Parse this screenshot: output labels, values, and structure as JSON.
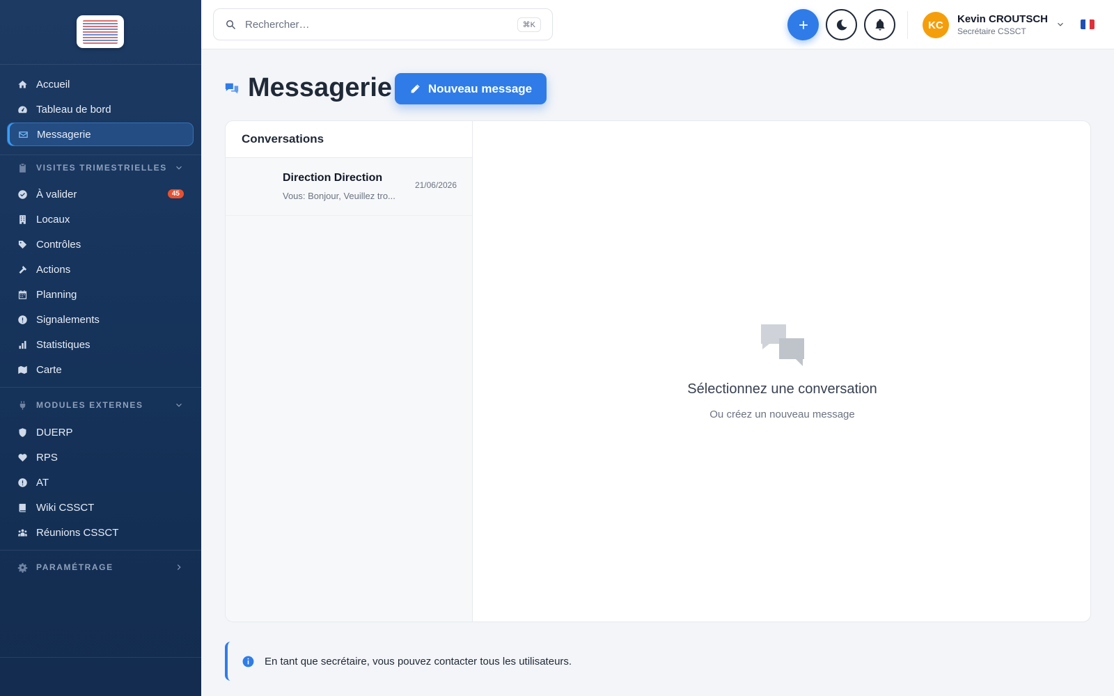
{
  "sidebar": {
    "nav_main": [
      {
        "label": "Accueil",
        "icon": "home-icon"
      },
      {
        "label": "Tableau de bord",
        "icon": "dashboard-icon"
      },
      {
        "label": "Messagerie",
        "icon": "envelope-icon"
      }
    ],
    "section_visites": "VISITES TRIMESTRIELLES",
    "visites_items": [
      {
        "label": "À valider",
        "icon": "check-circle-icon",
        "badge": "45"
      },
      {
        "label": "Locaux",
        "icon": "building-icon"
      },
      {
        "label": "Contrôles",
        "icon": "tag-icon"
      },
      {
        "label": "Actions",
        "icon": "hammer-icon"
      },
      {
        "label": "Planning",
        "icon": "calendar-icon"
      },
      {
        "label": "Signalements",
        "icon": "alert-icon"
      },
      {
        "label": "Statistiques",
        "icon": "bar-chart-icon"
      },
      {
        "label": "Carte",
        "icon": "map-icon"
      }
    ],
    "section_modules": "MODULES EXTERNES",
    "modules_items": [
      {
        "label": "DUERP",
        "icon": "shield-icon"
      },
      {
        "label": "RPS",
        "icon": "heart-icon"
      },
      {
        "label": "AT",
        "icon": "alert-icon"
      },
      {
        "label": "Wiki CSSCT",
        "icon": "book-icon"
      },
      {
        "label": "Réunions CSSCT",
        "icon": "users-icon"
      }
    ],
    "section_param": "PARAMÉTRAGE"
  },
  "topbar": {
    "search_placeholder": "Rechercher…",
    "search_shortcut": "⌘K",
    "user_initials": "KC",
    "user_name": "Kevin CROUTSCH",
    "user_role": "Secrétaire CSSCT"
  },
  "page": {
    "title": "Messagerie",
    "new_message_label": "Nouveau message"
  },
  "conversations": {
    "header": "Conversations",
    "items": [
      {
        "name": "Direction Direction",
        "preview": "Vous: Bonjour, Veuillez tro...",
        "date": "21/06/2026"
      }
    ]
  },
  "empty_state": {
    "title": "Sélectionnez une conversation",
    "subtitle": "Ou créez un nouveau message"
  },
  "info_banner": {
    "text": "En tant que secrétaire, vous pouvez contacter tous les utilisateurs."
  },
  "colors": {
    "accent": "#2f7ce8",
    "sidebar": "#16345c",
    "badge": "#e8512f",
    "avatar": "#f59e0b"
  }
}
